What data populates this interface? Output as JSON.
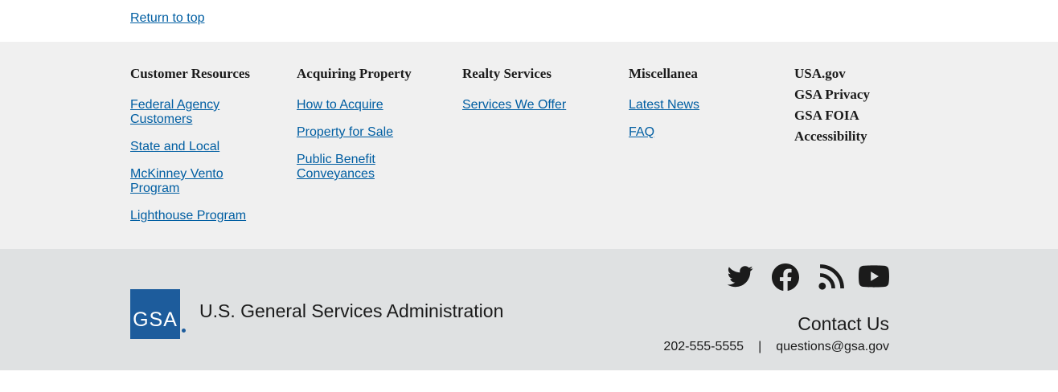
{
  "return_to_top": "Return to top",
  "columns": [
    {
      "heading": "Customer Resources",
      "links": [
        "Federal Agency Customers",
        "State and Local",
        "McKinney Vento Program",
        "Lighthouse Program"
      ]
    },
    {
      "heading": "Acquiring Property",
      "links": [
        "How to Acquire",
        "Property for Sale",
        "Public Benefit Conveyances"
      ]
    },
    {
      "heading": "Realty Services",
      "links": [
        "Services We Offer"
      ]
    },
    {
      "heading": "Miscellanea",
      "links": [
        "Latest News",
        "FAQ"
      ]
    }
  ],
  "gsa_links": [
    "USA.gov",
    "GSA Privacy",
    "GSA FOIA",
    "Accessibility"
  ],
  "logo": {
    "text": "GSA",
    "color": "#1d5c9c"
  },
  "agency_name": "U.S. General Services Administration",
  "social": [
    "twitter-icon",
    "facebook-icon",
    "rss-icon",
    "youtube-icon"
  ],
  "contact": {
    "heading": "Contact Us",
    "phone": "202-555-5555",
    "separator": "|",
    "email": "questions@gsa.gov"
  },
  "colors": {
    "link": "#005ea2",
    "primary_bg": "#f0f0f0",
    "secondary_bg": "#dfe1e2"
  }
}
